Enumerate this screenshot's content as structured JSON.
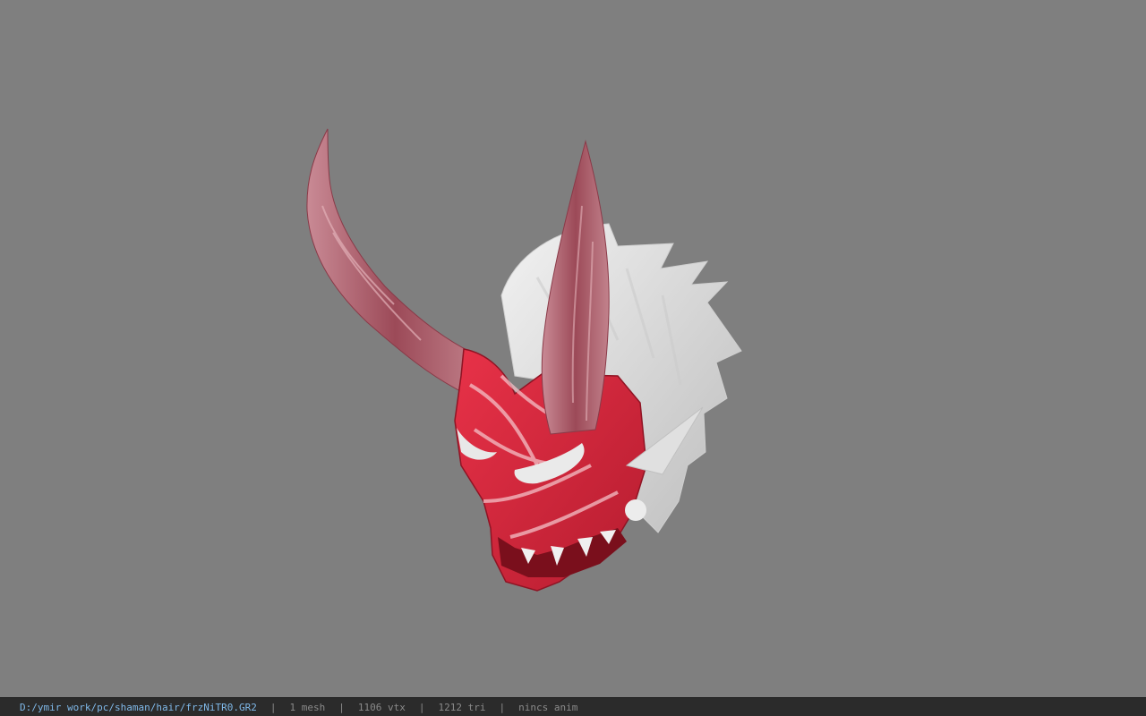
{
  "viewport": {
    "background_color": "#7f7f7f",
    "model": {
      "name": "oni-mask-icon",
      "mask_color": "#d8263a",
      "horn_color": "#a35866",
      "hair_color": "#e6e6e6"
    }
  },
  "statusbar": {
    "file_path": "D:/ymir work/pc/shaman/hair/frzNiTR0.GR2",
    "separator": "|",
    "mesh_count": "1 mesh",
    "vertex_count": "1106 vtx",
    "triangle_count": "1212 tri",
    "anim_status": "nincs anim",
    "path_color": "#7fb8e8"
  }
}
